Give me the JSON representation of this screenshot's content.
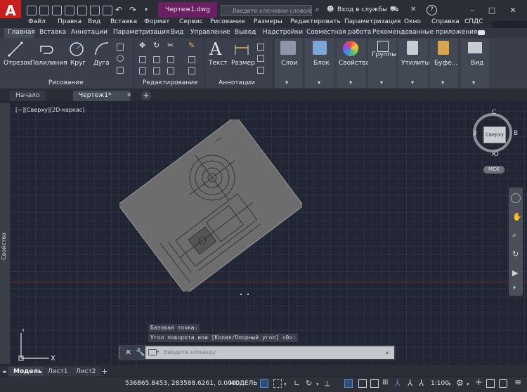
{
  "app": {
    "logo_letter": "A",
    "document_title": "Чертеж1.dwg",
    "search_placeholder": "Введите ключевое слово/фразу",
    "signin": "Вход в службы",
    "help": "?"
  },
  "menu": [
    "Файл",
    "Правка",
    "Вид",
    "Вставка",
    "Формат",
    "Сервис",
    "Рисование",
    "Размеры",
    "Редактировать",
    "Параметризация",
    "Окно",
    "Справка",
    "СПДС"
  ],
  "ribbon_tabs": [
    "Главная",
    "Вставка",
    "Аннотации",
    "Параметризация",
    "Вид",
    "Управление",
    "Вывод",
    "Надстройки",
    "Совместная работа",
    "Рекомендованные приложения"
  ],
  "ribbon": {
    "draw": {
      "line": "Отрезок",
      "polyline": "Полилиния",
      "circle": "Круг",
      "arc": "Дуга",
      "panel": "Рисование"
    },
    "modify": {
      "panel": "Редактирование"
    },
    "annotation": {
      "text": "Текст",
      "dimension": "Размер",
      "panel": "Аннотации"
    },
    "layers": "Слои",
    "block": "Блок",
    "properties": "Свойства",
    "groups": "Группы",
    "utilities": "Утилиты",
    "clipboard": "Буфе...",
    "view": "Вид"
  },
  "file_tabs": {
    "start": "Начало",
    "drawing": "Чертеж1*",
    "add": "+"
  },
  "viewport": {
    "label": "[−][Сверху][2D-каркас]",
    "side_palette": "Свойства",
    "viewcube": {
      "top_face": "Сверху",
      "north": "С",
      "south": "Ю",
      "east": "В",
      "west": "З",
      "ucs": "МСК"
    }
  },
  "command": {
    "history": [
      "Базовая точка:",
      "Угол поворота или [Копия/Опорный угол] <0>:"
    ],
    "placeholder": "Введите команду"
  },
  "layout_tabs": [
    "Модель",
    "Лист1",
    "Лист2"
  ],
  "status": {
    "coords": "536865.8453, 283588.6261, 0.0000",
    "space": "МОДЕЛЬ",
    "scale": "1:100"
  },
  "colors": {
    "title_accent": "#6b1f63",
    "logo": "#c81e1e",
    "viewport_bg": "#212632"
  }
}
